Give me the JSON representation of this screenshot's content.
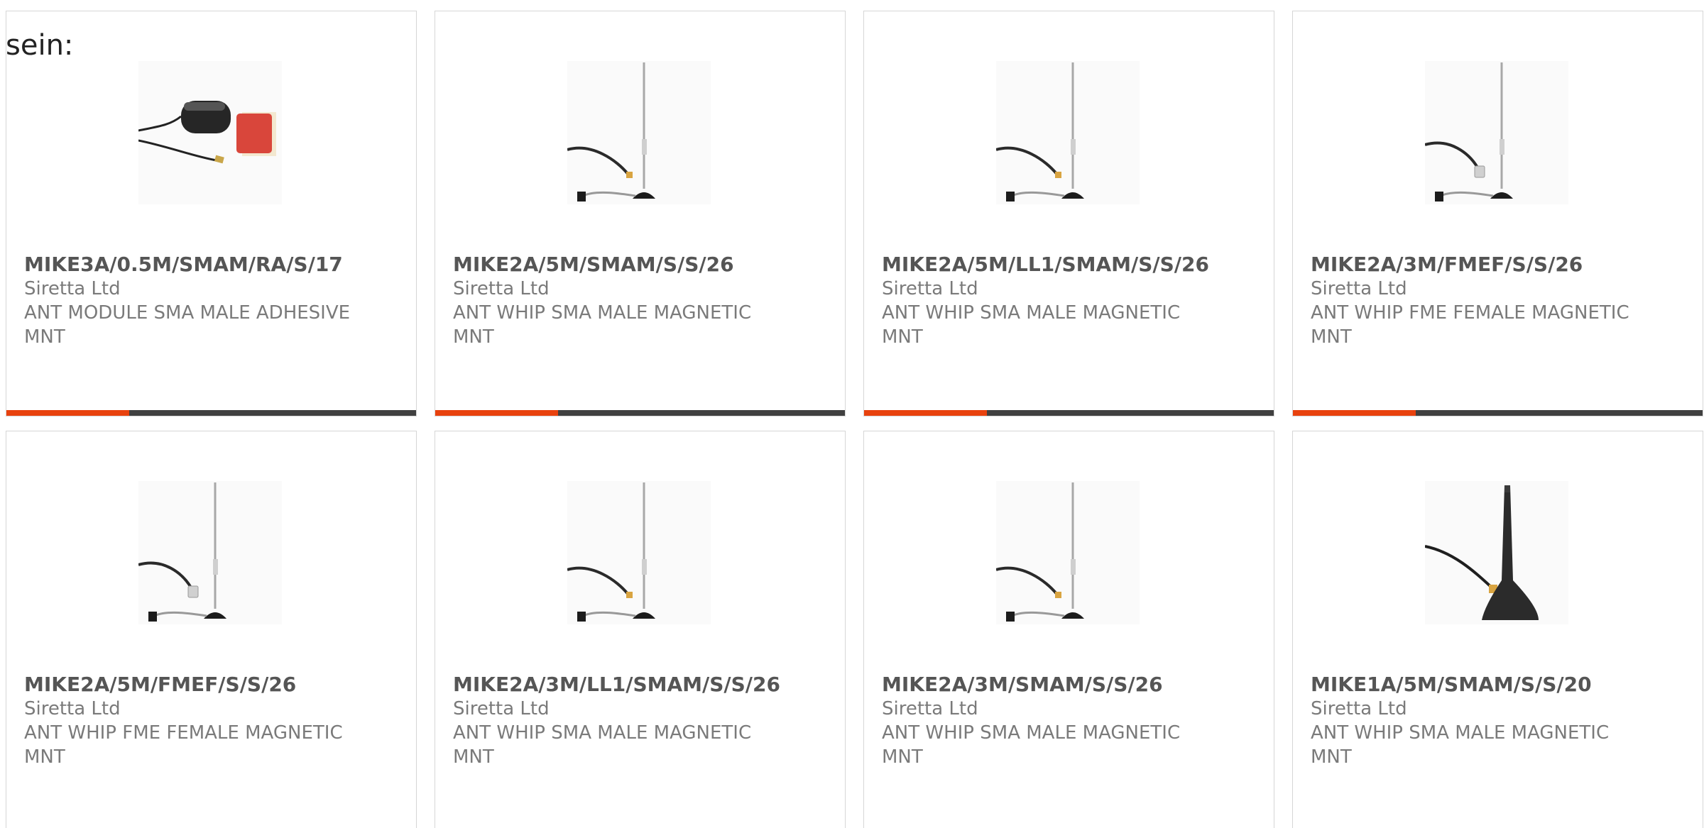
{
  "intro_text": "sein:",
  "colors": {
    "accent": "#e8420e",
    "bar_track": "#404040",
    "part_text": "#555555",
    "meta_text": "#7a7a7a",
    "card_border": "#d6d6d6"
  },
  "products": [
    {
      "part": "MIKE3A/0.5M/SMAM/RA/S/17",
      "manufacturer": "Siretta Ltd",
      "description": "ANT MODULE SMA MALE ADHESIVE MNT",
      "image": "adhesive-antenna-module",
      "progress_fraction": 0.3
    },
    {
      "part": "MIKE2A/5M/SMAM/S/S/26",
      "manufacturer": "Siretta Ltd",
      "description": "ANT WHIP SMA MALE MAGNETIC MNT",
      "image": "magnetic-whip-antenna-sma",
      "progress_fraction": 0.3
    },
    {
      "part": "MIKE2A/5M/LL1/SMAM/S/S/26",
      "manufacturer": "Siretta Ltd",
      "description": "ANT WHIP SMA MALE MAGNETIC MNT",
      "image": "magnetic-whip-antenna-sma",
      "progress_fraction": 0.3
    },
    {
      "part": "MIKE2A/3M/FMEF/S/S/26",
      "manufacturer": "Siretta Ltd",
      "description": "ANT WHIP FME FEMALE MAGNETIC MNT",
      "image": "magnetic-whip-antenna-fme",
      "progress_fraction": 0.3
    },
    {
      "part": "MIKE2A/5M/FMEF/S/S/26",
      "manufacturer": "Siretta Ltd",
      "description": "ANT WHIP FME FEMALE MAGNETIC MNT",
      "image": "magnetic-whip-antenna-fme"
    },
    {
      "part": "MIKE2A/3M/LL1/SMAM/S/S/26",
      "manufacturer": "Siretta Ltd",
      "description": "ANT WHIP SMA MALE MAGNETIC MNT",
      "image": "magnetic-whip-antenna-sma"
    },
    {
      "part": "MIKE2A/3M/SMAM/S/S/26",
      "manufacturer": "Siretta Ltd",
      "description": "ANT WHIP SMA MALE MAGNETIC MNT",
      "image": "magnetic-whip-antenna-sma"
    },
    {
      "part": "MIKE1A/5M/SMAM/S/S/20",
      "manufacturer": "Siretta Ltd",
      "description": "ANT WHIP SMA MALE MAGNETIC MNT",
      "image": "stubby-magnetic-antenna"
    }
  ]
}
